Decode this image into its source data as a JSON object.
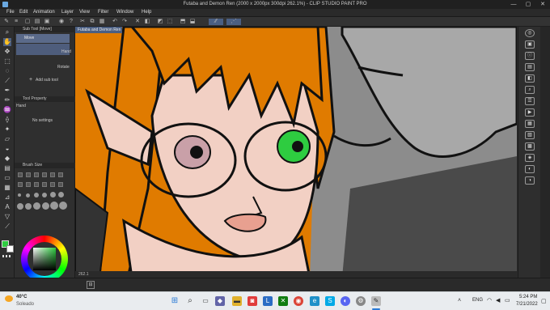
{
  "window": {
    "title": "Futaba and Demon Ren (2000 x 2000px 300dpi 262.1%) - CLIP STUDIO PAINT PRO",
    "minimize": "—",
    "maximize": "▢",
    "close": "✕"
  },
  "menu": [
    "File",
    "Edit",
    "Animation",
    "Layer",
    "View",
    "Filter",
    "Window",
    "Help"
  ],
  "sub_tool": {
    "header": "Sub Tool [Move]",
    "items": [
      "Move",
      "Hand"
    ],
    "rotate_label": "Rotate",
    "add_label": "Add sub tool"
  },
  "tool_property": {
    "header": "Tool Property",
    "tool_name": "Hand",
    "no_settings": "No settings"
  },
  "brush_size": {
    "header": "Brush Size"
  },
  "canvas": {
    "tab_label": "Futaba and Demon Ren",
    "zoom": "262.1"
  },
  "color": {
    "main": "#2ecc40",
    "sub": "#ffffff"
  },
  "colors": {
    "orange": "#e07b00",
    "skin": "#f2d0c4",
    "gray": "#8c8c8c",
    "accent_blue": "#4b5f82"
  },
  "taskbar": {
    "temperature": "40°C",
    "weather": "Soleado",
    "lang": "ENG",
    "time": "5:24 PM",
    "date": "7/21/2022"
  }
}
